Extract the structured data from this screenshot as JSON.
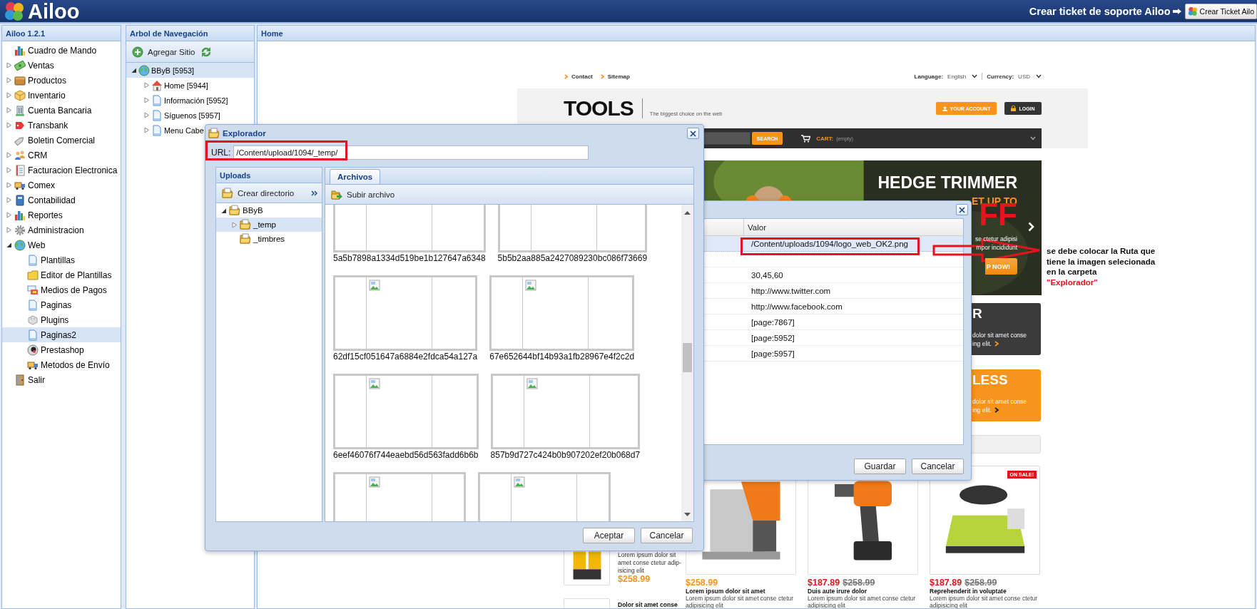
{
  "top_bar": {
    "logo": "Ailoo",
    "support_link": "Crear ticket de soporte Ailoo",
    "ticket_button": "Crear Ticket Ailo"
  },
  "sidebar": {
    "title": "Ailoo 1.2.1",
    "items": [
      {
        "label": "Cuadro de Mando",
        "selected": false
      },
      {
        "label": "Ventas",
        "expanded": false,
        "selected": false
      },
      {
        "label": "Productos",
        "expanded": false,
        "selected": false
      },
      {
        "label": "Inventario",
        "expanded": false,
        "selected": false
      },
      {
        "label": "Cuenta Bancaria",
        "expanded": false,
        "selected": false
      },
      {
        "label": "Transbank",
        "expanded": false,
        "selected": false
      },
      {
        "label": "Boletin Comercial",
        "selected": false
      },
      {
        "label": "CRM",
        "expanded": false,
        "selected": false
      },
      {
        "label": "Facturacion Electronica",
        "expanded": false,
        "selected": false
      },
      {
        "label": "Comex",
        "expanded": false,
        "selected": false
      },
      {
        "label": "Contabilidad",
        "expanded": false,
        "selected": false
      },
      {
        "label": "Reportes",
        "expanded": false,
        "selected": false
      },
      {
        "label": "Administracion",
        "expanded": false,
        "selected": false
      },
      {
        "label": "Web",
        "expanded": true,
        "selected": false,
        "children": [
          {
            "label": "Plantillas",
            "selected": false
          },
          {
            "label": "Editor de Plantillas",
            "selected": false
          },
          {
            "label": "Medios de Pagos",
            "selected": false
          },
          {
            "label": "Paginas",
            "selected": false
          },
          {
            "label": "Plugins",
            "selected": false
          },
          {
            "label": "Paginas2",
            "selected": true
          },
          {
            "label": "Prestashop",
            "selected": false
          },
          {
            "label": "Metodos de Envío",
            "selected": false
          }
        ]
      },
      {
        "label": "Salir",
        "selected": false
      }
    ]
  },
  "navigation": {
    "title": "Arbol de Navegación",
    "add_button": "Agregar Sitio",
    "tree": [
      {
        "label": "BByB [5953]",
        "expanded": true,
        "selected": true,
        "children": [
          {
            "label": "Home [5944]",
            "expanded": false,
            "selected": false
          },
          {
            "label": "Información [5952]",
            "expanded": false,
            "selected": false
          },
          {
            "label": "Síguenos [5957]",
            "expanded": false,
            "selected": false
          },
          {
            "label": "Menu Cabe",
            "expanded": false,
            "selected": false
          }
        ]
      }
    ]
  },
  "home": {
    "title": "Home",
    "site": {
      "links": [
        "Contact",
        "Sitemap"
      ],
      "language_label": "Language:",
      "language": "English",
      "currency_label": "Currency:",
      "currency": "USD",
      "logo": "TOOLS",
      "tagline": "The biggest choice on the web",
      "account_button": "YOUR ACCOUNT",
      "login_button": "LOGIN",
      "search_button": "SEARCH",
      "cart_label": "CART:",
      "cart_value": "(empty)",
      "hero": {
        "title": "HEDGE TRIMMER",
        "subtitle": "ET UP TO",
        "offer": "FF",
        "lines": [
          "se ctetur adipisi",
          "mpor incididunt"
        ],
        "button": "P NOW!"
      },
      "banners": [
        {
          "title": "R",
          "lines": [
            "dolor sit amet conse",
            "ing elit."
          ],
          "color": "#3b3b3b"
        },
        {
          "title": "LESS",
          "lines": [
            "dolor sit amet conse",
            "ing elit."
          ],
          "color": "#f7941d"
        }
      ],
      "side_product": {
        "description": "Lorem ipsum dolor sit\namet conse ctetur adip-\nisicing elit",
        "price": "$258.99",
        "next_title": "Dolor sit amet conse"
      },
      "products": [
        {
          "price": "$258.99",
          "name": "Lorem ipsum dolor sit amet",
          "description": "Lorem ipsum dolor sit amet conse ctetur adipisicing elit"
        },
        {
          "price": "$187.89",
          "old_price": "$258.99",
          "name": "Duis aute irure dolor",
          "description": "Lorem ipsum dolor sit amet conse ctetur adipisicing elit"
        },
        {
          "price": "$187.89",
          "old_price": "$258.99",
          "name": "Reprehenderit in voluptate",
          "description": "Lorem ipsum dolor sit amet conse ctetur adipisicing elit",
          "on_sale": true,
          "badge": "ON SALE!"
        }
      ]
    }
  },
  "properties_dialog": {
    "column": "Valor",
    "rows": [
      {
        "value": "/Content/uploads/1094/logo_web_OK2.png",
        "selected": true
      },
      {
        "selected": false
      },
      {
        "value": "30,45,60",
        "selected": false
      },
      {
        "value": "http://www.twitter.com",
        "selected": false
      },
      {
        "value": "http://www.facebook.com",
        "selected": false
      },
      {
        "value": "[page:7867]",
        "selected": false
      },
      {
        "value": "[page:5952]",
        "selected": false
      },
      {
        "value": "[page:5957]",
        "selected": false
      }
    ],
    "buttons": [
      "Guardar",
      "Cancelar"
    ]
  },
  "explorer": {
    "title": "Explorador",
    "url_label": "URL:",
    "url": "/Content/upload/1094/_temp/",
    "folders_title": "Uploads",
    "create_button": "Crear directorio",
    "tree": [
      {
        "label": "BByB",
        "expanded": true,
        "selected": false,
        "children": [
          {
            "label": "_temp",
            "expanded": false,
            "selected": true
          },
          {
            "label": "_timbres",
            "selected": false
          }
        ]
      }
    ],
    "tab": {
      "label": "Archivos",
      "selected": true
    },
    "upload_button": "Subir archivo",
    "files": [
      {
        "kind": "thumbnail",
        "caption": "5a5b7898a1334d519be1b127647a6348"
      },
      {
        "kind": "thumbnail",
        "caption": "5b5b2aa885a2427089230bc086f73669"
      },
      {
        "kind": "thumbnail",
        "caption": "62df15cf051647a6884e2fdca54a127a"
      },
      {
        "kind": "thumbnail",
        "caption": "67e652644bf14b93a1fb28967e4f2c2d"
      },
      {
        "kind": "thumbnail",
        "caption": "6eef46076f744eaebd56d563fadd6b6b"
      },
      {
        "kind": "thumbnail",
        "caption": "857b9d727c424b0b907202ef20b068d7"
      },
      {
        "kind": "thumbnail"
      },
      {
        "kind": "thumbnail"
      }
    ],
    "buttons": [
      "Aceptar",
      "Cancelar"
    ]
  },
  "annotation": {
    "note": "se debe colocar la Ruta que tiene la imagen selecionada en la carpeta",
    "keyword": "\"Explorador\""
  }
}
